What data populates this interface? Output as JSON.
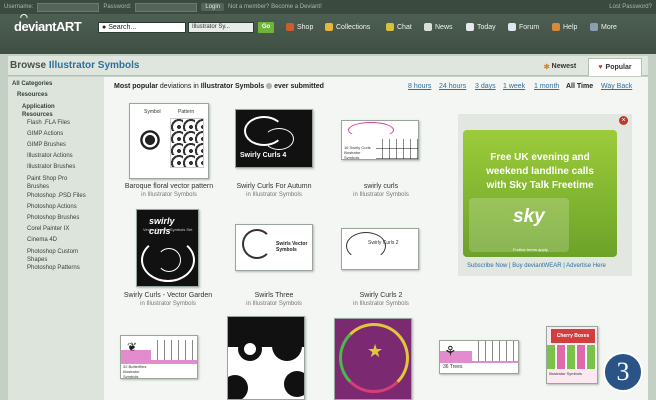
{
  "topbar": {
    "username_label": "Username:",
    "password_label": "Password:",
    "login": "Login",
    "member_text": "Not a member? Become a Deviant!",
    "lost": "Lost Password?"
  },
  "brand": {
    "name": "deviantART"
  },
  "search": {
    "value": "Search...",
    "category": "Illustrator Sy...",
    "go": "Go"
  },
  "nav": [
    {
      "label": "Shop",
      "color": "#cf5a2e"
    },
    {
      "label": "Collections",
      "color": "#e7b53b"
    },
    {
      "label": "Chat",
      "color": "#d7c13b"
    },
    {
      "label": "News",
      "color": "#d8e0dc"
    },
    {
      "label": "Today",
      "color": "#e6eaef"
    },
    {
      "label": "Forum",
      "color": "#dfe7ef"
    },
    {
      "label": "Help",
      "color": "#d88a3b"
    },
    {
      "label": "More",
      "color": "#8aa0af"
    }
  ],
  "page": {
    "title_prefix": "Browse",
    "title_cat": "Illustrator Symbols"
  },
  "tabs": {
    "newest": "Newest",
    "popular": "Popular"
  },
  "sidebar": {
    "all": "All Categories",
    "resources": "Resources",
    "app": "Application Resources",
    "items": [
      "Flash .FLA Files",
      "GIMP Actions",
      "GIMP Brushes",
      "Illustrator Actions",
      "Illustrator Brushes",
      "Paint Shop Pro Brushes",
      "Photoshop .PSD Files",
      "Photoshop Actions",
      "Photoshop Brushes",
      "Corel Painter IX",
      "Cinema 4D",
      "Photoshop Custom Shapes",
      "Photoshop Patterns"
    ]
  },
  "sort": {
    "most": "Most popular",
    "mid": "deviations in",
    "cat": "Illustrator Symbols",
    "ever": "ever submitted",
    "filters": [
      "8 hours",
      "24 hours",
      "3 days",
      "1 week",
      "1 month",
      "All Time",
      "Way Back"
    ],
    "current": "All Time"
  },
  "thumbs": [
    {
      "title": "Baroque floral vector pattern",
      "cat": "in Illustrator Symbols"
    },
    {
      "title": "Swirly Curls For Autumn",
      "cat": "in Illustrator Symbols"
    },
    {
      "title": "swirly curls",
      "cat": "in Illustrator Symbols"
    },
    {
      "title": "Swirly Curls - Vector Garden",
      "cat": "in Illustrator Symbols"
    },
    {
      "title": "Swirls Three",
      "cat": "in Illustrator Symbols"
    },
    {
      "title": "Swirly Curls 2",
      "cat": "in Illustrator Symbols"
    }
  ],
  "thumb_labels": {
    "t1a": "Symbol",
    "t1b": "Pattern",
    "t2": "Swirly Curls 4",
    "t3": "16 Swirly Curls Illustrator Symbols",
    "t4a": "swirly curls",
    "t4b": "Vector Garden Symbols Set",
    "t5": "Swirls Vector Symbols",
    "t6": "Swirly Curls 2",
    "b1": "32 Butterflies Illustrator Symbols",
    "b5": "36 Trees",
    "b6a": "Cherry Boxes",
    "b6b": "Illustrator Symbols"
  },
  "ad": {
    "line1": "Free UK evening and",
    "line2": "weekend landline calls",
    "line3": "with Sky Talk Freetime",
    "sky": "sky",
    "terms": "Further terms apply.",
    "links": "Subscribe Now | Buy deviantWEAR | Advertise Here"
  },
  "badge": "3"
}
